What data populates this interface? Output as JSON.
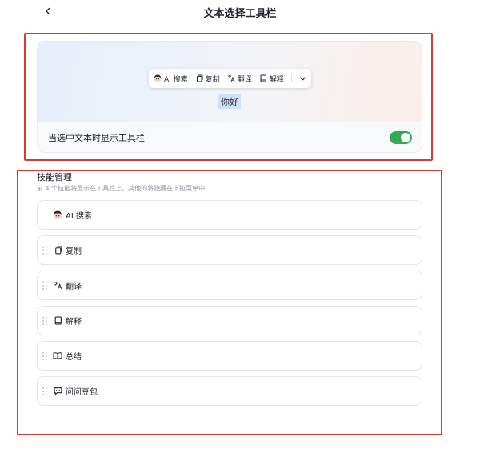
{
  "header": {
    "title": "文本选择工具栏",
    "back_icon": "chevron-left-icon"
  },
  "preview": {
    "toolbar": [
      {
        "label": "AI 搜索",
        "icon": "ai-avatar-icon"
      },
      {
        "label": "复制",
        "icon": "copy-icon"
      },
      {
        "label": "翻译",
        "icon": "translate-icon"
      },
      {
        "label": "解释",
        "icon": "book-icon"
      }
    ],
    "more_icon": "chevron-down-icon",
    "selected_text": "你好"
  },
  "setting": {
    "label": "当选中文本时显示工具栏",
    "enabled": true,
    "accent": "#34a853"
  },
  "skills": {
    "title": "技能管理",
    "description": "前 4 个技能将显示在工具栏上，其他的将隐藏在下拉菜单中",
    "items": [
      {
        "label": "AI 搜索",
        "icon": "ai-avatar-icon"
      },
      {
        "label": "复制",
        "icon": "copy-icon"
      },
      {
        "label": "翻译",
        "icon": "translate-icon"
      },
      {
        "label": "解释",
        "icon": "book-icon"
      },
      {
        "label": "总结",
        "icon": "open-book-icon"
      },
      {
        "label": "问问豆包",
        "icon": "chat-bubble-icon"
      }
    ]
  },
  "highlight_color": "#d93a34"
}
